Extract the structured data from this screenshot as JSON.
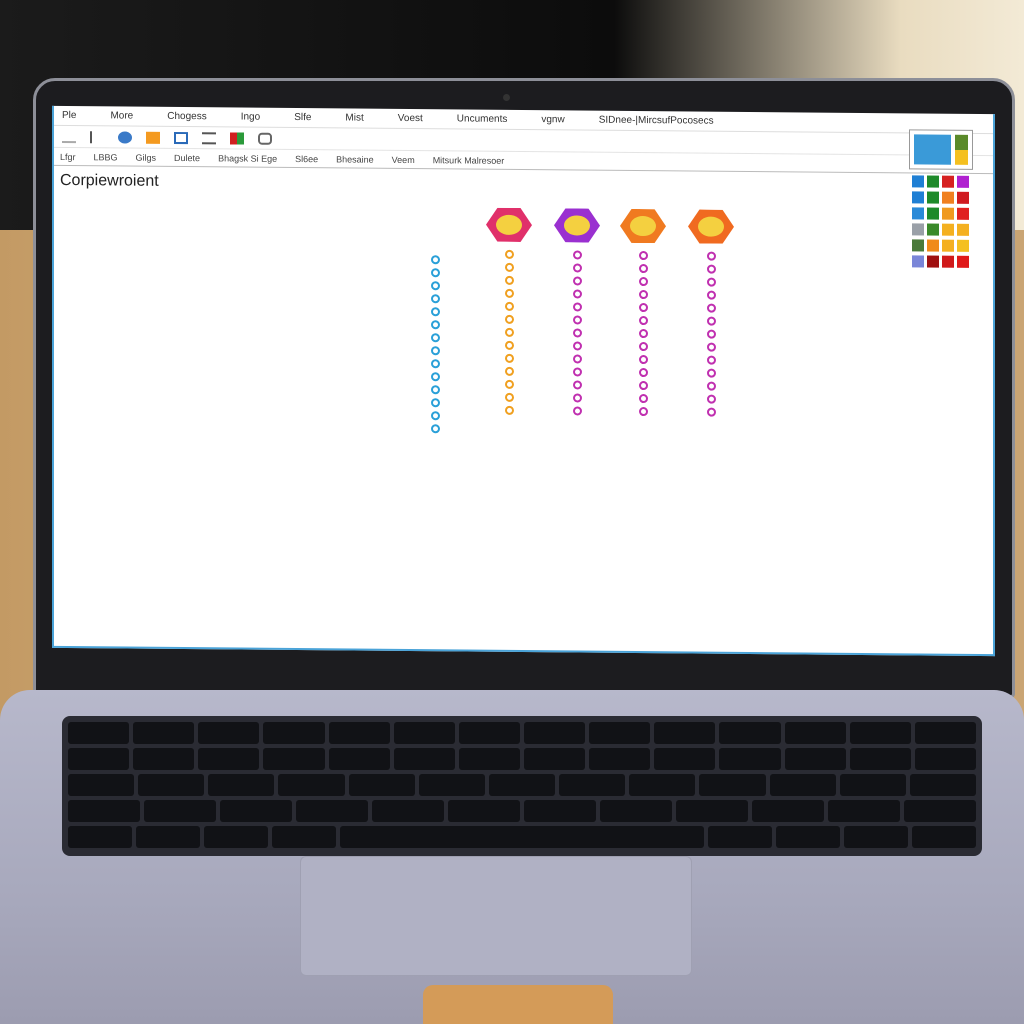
{
  "app": {
    "menu": [
      "Ple",
      "More",
      "Chogess",
      "Ingo",
      "Slfe",
      "Mist",
      "Voest",
      "Uncuments",
      "vgnw",
      "SIDnee-|MircsufPocosecs"
    ],
    "toolbar_row3": [
      "Lfgr",
      "LBBG",
      "Gilgs",
      "Dulete",
      "Bhagsk Si Ege",
      "Sl6ee",
      "Bhesaine",
      "Veem",
      "Mitsurk Malresoer"
    ],
    "document_title": "Corpiewroient"
  },
  "colors": {
    "accent": "#4aa3d8",
    "palette": [
      "#1f7fd4",
      "#1e8a2a",
      "#d62020",
      "#b020d0",
      "#1f7fd4",
      "#1e8a2a",
      "#f08020",
      "#d01a20",
      "#2a8ad8",
      "#1e8a2a",
      "#f09a20",
      "#e02020",
      "#9aa0a8",
      "#3a8a2a",
      "#f4b020",
      "#f4b020",
      "#4a7a3a",
      "#f08a1a",
      "#f4b020",
      "#f4c020",
      "#7a86d8",
      "#a01010",
      "#d01a1a",
      "#e01a1a"
    ]
  },
  "columns": [
    {
      "badge": null,
      "color": "#2aa0d8",
      "count": 14
    },
    {
      "badge": "#e0306a",
      "color": "#f0a020",
      "count": 13
    },
    {
      "badge": "#9a30d0",
      "color": "#c030b0",
      "count": 13
    },
    {
      "badge": "#f07a20",
      "color": "#c030b0",
      "count": 13
    },
    {
      "badge": "#f06a20",
      "color": "#c030b0",
      "count": 13
    }
  ]
}
